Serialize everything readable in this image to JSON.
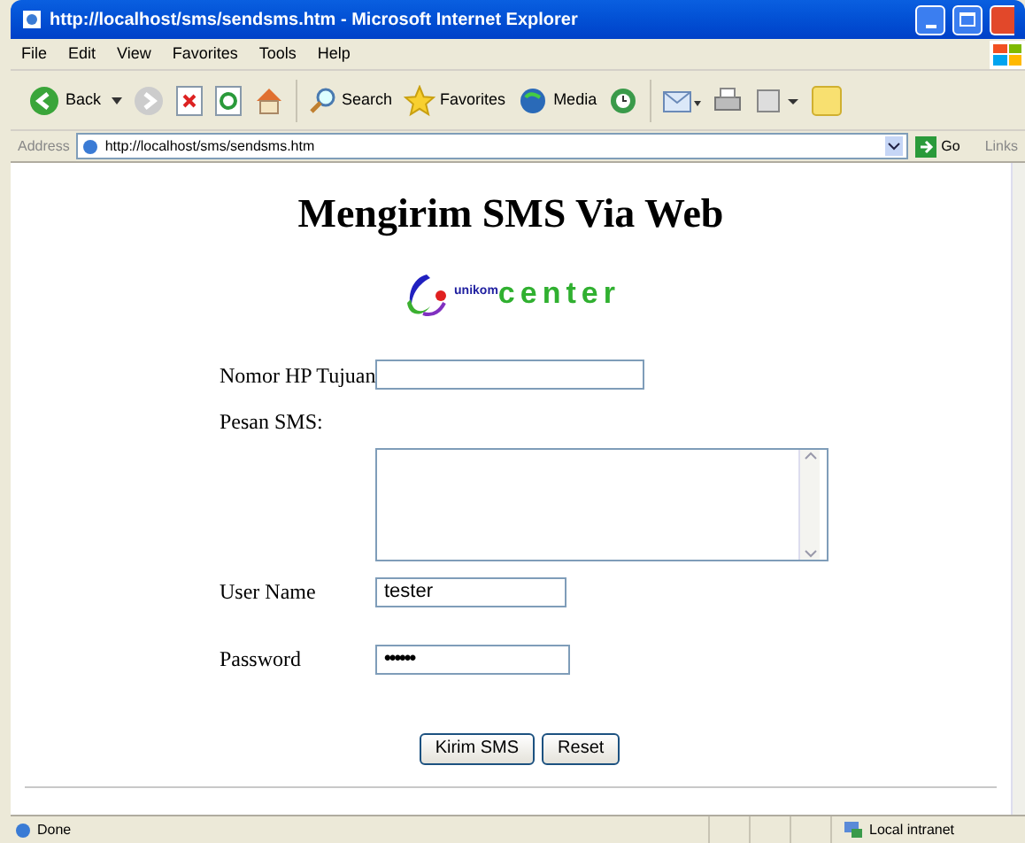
{
  "window": {
    "title": "http://localhost/sms/sendsms.htm - Microsoft Internet Explorer"
  },
  "menu": [
    "File",
    "Edit",
    "View",
    "Favorites",
    "Tools",
    "Help"
  ],
  "toolbar": {
    "back": "Back",
    "search": "Search",
    "favorites": "Favorites",
    "media": "Media"
  },
  "address": {
    "label": "Address",
    "url": "http://localhost/sms/sendsms.htm",
    "go": "Go",
    "links": "Links"
  },
  "page": {
    "heading": "Mengirim SMS Via Web",
    "logo": {
      "small": "unikom",
      "large": "center"
    },
    "fields": [
      {
        "kind": "input",
        "label": "Nomor HP Tujuan"
      },
      {
        "kind": "textarea",
        "label": "Pesan SMS:"
      },
      {
        "kind": "input",
        "label": "User Name",
        "value": "tester"
      },
      {
        "kind": "password",
        "label": "Password",
        "value": "••••••"
      }
    ],
    "buttons": [
      "Kirim SMS",
      "Reset"
    ]
  },
  "status_bar": {
    "text": "Done",
    "zone": "Local intranet"
  }
}
